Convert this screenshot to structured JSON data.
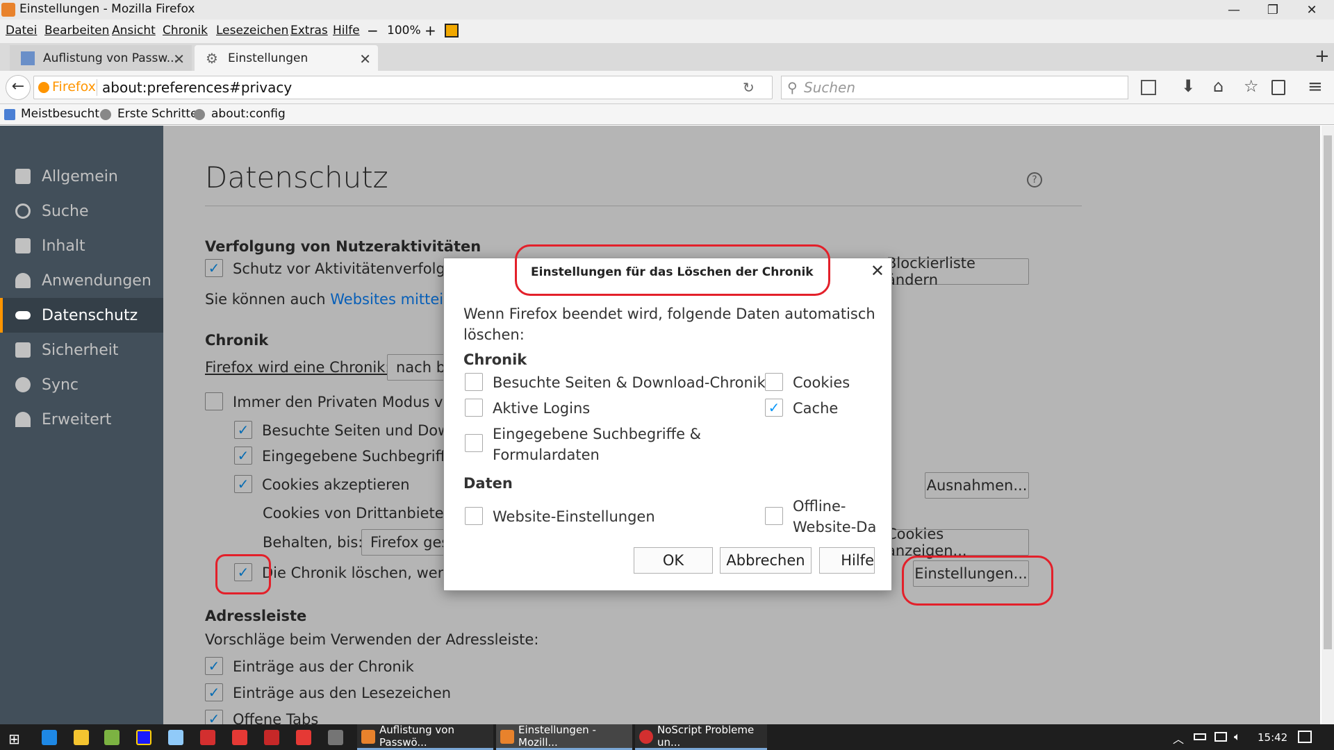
{
  "window": {
    "title": "Einstellungen - Mozilla Firefox",
    "minimize": "—",
    "maximize": "❐",
    "close": "✕"
  },
  "menu": {
    "items": [
      "Datei",
      "Bearbeiten",
      "Ansicht",
      "Chronik",
      "Lesezeichen",
      "Extras",
      "Hilfe"
    ],
    "zoom_minus": "−",
    "zoom": "100%",
    "zoom_plus": "+"
  },
  "tabs": [
    {
      "title": "Auflistung von Passw...",
      "close": "✕"
    },
    {
      "title": "Einstellungen",
      "close": "✕"
    }
  ],
  "new_tab": "+",
  "nav": {
    "back": "←",
    "identity": "Firefox",
    "url": "about:preferences#privacy",
    "reload": "↻",
    "search_placeholder": "Suchen"
  },
  "bookmarks": [
    "Meistbesucht",
    "Erste Schritte",
    "about:config"
  ],
  "sidebar": {
    "items": [
      "Allgemein",
      "Suche",
      "Inhalt",
      "Anwendungen",
      "Datenschutz",
      "Sicherheit",
      "Sync",
      "Erweitert"
    ]
  },
  "page": {
    "title": "Datenschutz",
    "tracking": {
      "heading": "Verfolgung von Nutzeraktivitäten",
      "protect": "Schutz vor Aktivitätenverfolgu",
      "blocklist_btn": "Blockierliste ändern",
      "info_prefix": "Sie können auch ",
      "info_link": "Websites mitteile"
    },
    "history": {
      "heading": "Chronik",
      "mode_label": "Firefox wird eine Chronik:",
      "mode_value": "nach b",
      "private": "Immer den Privaten Modus ve",
      "visited": "Besuchte Seiten und Dow",
      "search": "Eingegebene Suchbegriffe",
      "cookies": "Cookies akzeptieren",
      "exceptions_btn": "Ausnahmen...",
      "third_party": "Cookies von Drittanbieter",
      "keep_label": "Behalten, bis:",
      "keep_value": "Firefox ges",
      "show_cookies_btn": "Cookies anzeigen...",
      "clear": "Die Chronik löschen, wenn",
      "settings_btn": "Einstellungen..."
    },
    "addressbar": {
      "heading": "Adressleiste",
      "label": "Vorschläge beim Verwenden der Adressleiste:",
      "history": "Einträge aus der Chronik",
      "bookmarks": "Einträge aus den Lesezeichen",
      "tabs": "Offene Tabs"
    }
  },
  "dialog": {
    "title": "Einstellungen für das Löschen der Chronik",
    "close": "✕",
    "desc1": "Wenn Firefox beendet wird, folgende Daten automatisch",
    "desc2": "löschen:",
    "chronik_heading": "Chronik",
    "visited": "Besuchte Seiten & Download-Chronik",
    "logins": "Aktive Logins",
    "forms1": "Eingegebene Suchbegriffe &",
    "forms2": "Formulardaten",
    "cookies": "Cookies",
    "cache": "Cache",
    "daten_heading": "Daten",
    "site_settings": "Website-Einstellungen",
    "offline1": "Offline-",
    "offline2": "Website-Dat",
    "ok": "OK",
    "cancel": "Abbrechen",
    "help": "Hilfe"
  },
  "taskbar": {
    "tasks": [
      "Auflistung von Passwö...",
      "Einstellungen - Mozill...",
      "NoScript Probleme un..."
    ],
    "clock": "15:42"
  },
  "colors": {
    "sidebar": "#424f5a",
    "accent": "#ff9500",
    "checkbox": "#0996f8",
    "annotation": "#e3202a"
  }
}
